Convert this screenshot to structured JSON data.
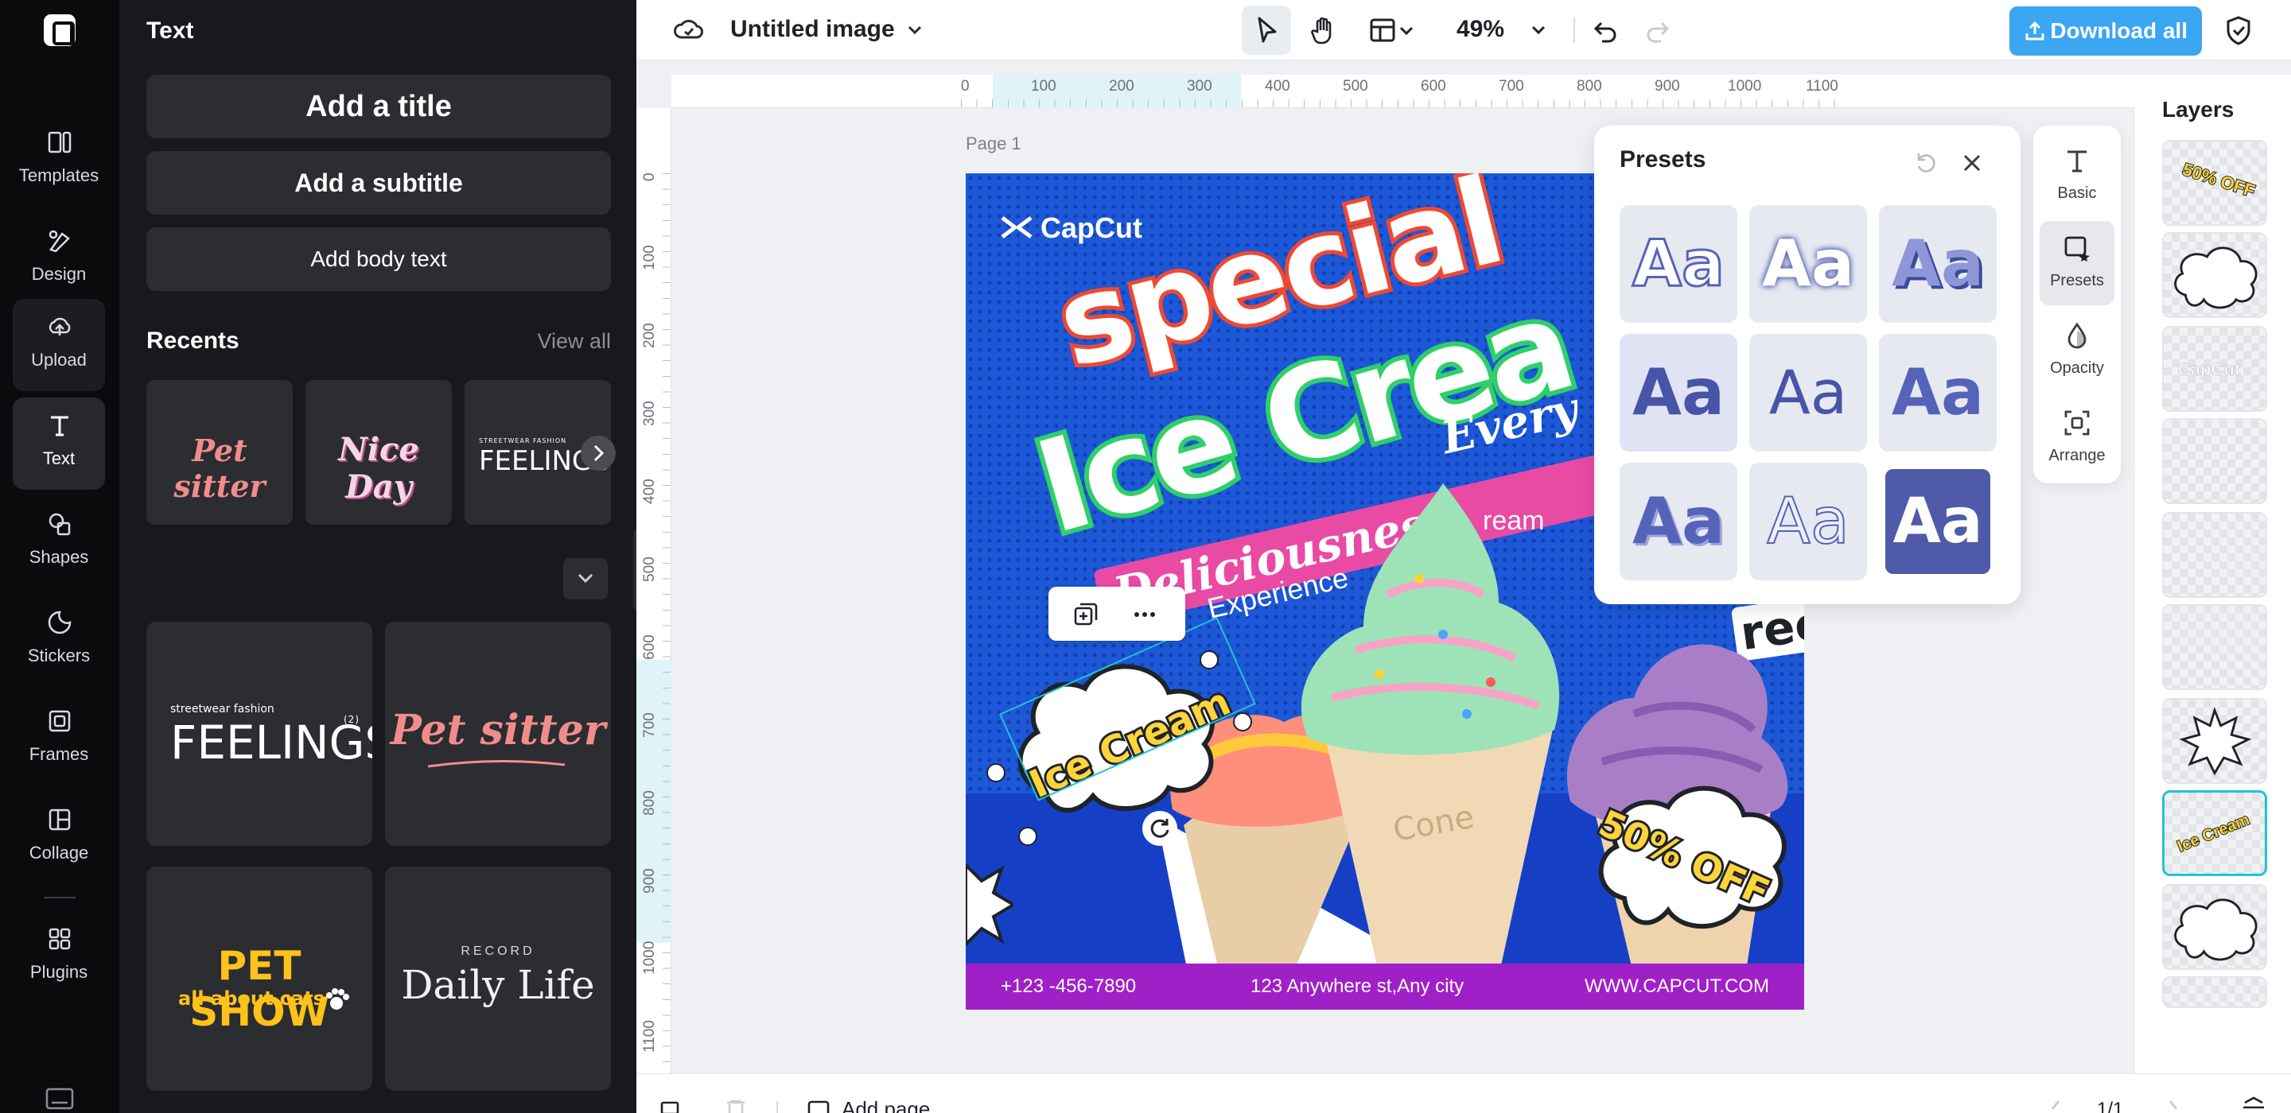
{
  "app": {
    "doc_title": "Untitled image",
    "zoom": "49%",
    "download_label": "Download all"
  },
  "rail": {
    "items": [
      {
        "label": "Templates"
      },
      {
        "label": "Design"
      },
      {
        "label": "Upload"
      },
      {
        "label": "Text"
      },
      {
        "label": "Shapes"
      },
      {
        "label": "Stickers"
      },
      {
        "label": "Frames"
      },
      {
        "label": "Collage"
      },
      {
        "label": "Plugins"
      }
    ]
  },
  "panel": {
    "title": "Text",
    "add_title": "Add a title",
    "add_subtitle": "Add a subtitle",
    "add_body": "Add body text",
    "recents_label": "Recents",
    "view_all": "View all",
    "recents": [
      {
        "text": "Pet sitter"
      },
      {
        "text": "Nice Day"
      },
      {
        "small": "STREETWEAR FASHION",
        "text": "FEELINGS"
      }
    ],
    "gallery": [
      {
        "small": "streetwear fashion",
        "text": "FEELINGS",
        "sup": "(2)"
      },
      {
        "text": "Pet sitter"
      },
      {
        "text": "PET SHOW",
        "sub": "all about cats"
      },
      {
        "small": "RECORD",
        "text": "Daily Life"
      }
    ]
  },
  "ruler": {
    "h": [
      "0",
      "100",
      "200",
      "300",
      "400",
      "500",
      "600",
      "700",
      "800",
      "900",
      "1000",
      "1100"
    ],
    "v": [
      "0",
      "100",
      "200",
      "300",
      "400",
      "500",
      "600",
      "700",
      "800",
      "900",
      "1000",
      "1100"
    ]
  },
  "canvas": {
    "page_label": "Page 1",
    "brand": "CapCut",
    "headline1": "special",
    "headline2": "Ice Crea",
    "tagline1": "Deliciousness",
    "tagline2": "Every",
    "tagline3": "Experience",
    "tagline4": "ream",
    "free_text": "ree",
    "selected_text": "Ice Cream",
    "cone_text": "Cone",
    "badge": "50% OFF",
    "footer_phone": "+123 -456-7890",
    "footer_address": "123 Anywhere st,Any city",
    "footer_web": "WWW.CAPCUT.COM"
  },
  "presets": {
    "title": "Presets",
    "cells": [
      "Aa",
      "Aa",
      "Aa",
      "Aa",
      "Aa",
      "Aa",
      "Aa",
      "Aa",
      "Aa"
    ]
  },
  "side_tools": [
    {
      "label": "Basic"
    },
    {
      "label": "Presets"
    },
    {
      "label": "Opacity"
    },
    {
      "label": "Arrange"
    }
  ],
  "layers": {
    "title": "Layers",
    "thumb_texts": {
      "off": "50% OFF",
      "brand": "CapCut",
      "ice": "Ice Cream"
    }
  },
  "bottom": {
    "add_page": "Add page",
    "page_count": "1/1"
  },
  "colors": {
    "accent": "#3ba6f2",
    "selection": "#22c3d6",
    "footer": "#a020c8",
    "canvas_bg": "#1c58d8"
  }
}
